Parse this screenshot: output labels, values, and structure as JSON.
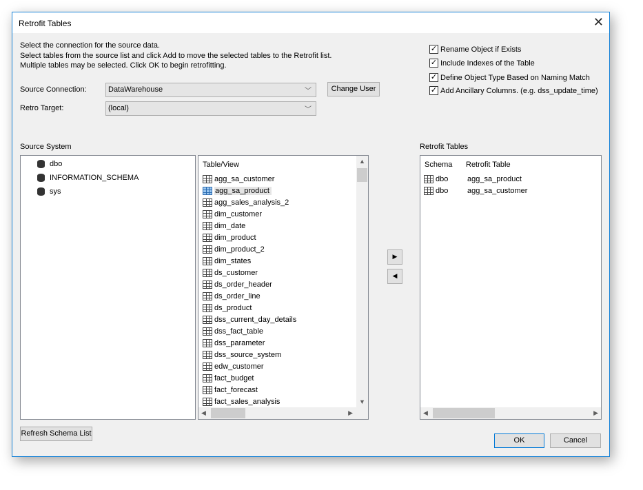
{
  "title": "Retrofit Tables",
  "instructions": [
    "Select the connection for the source data.",
    "Select tables from the source list and click Add to move the selected tables to the Retrofit list.",
    "Multiple tables may be selected. Click OK to begin retrofitting."
  ],
  "source_connection": {
    "label": "Source Connection:",
    "value": "DataWarehouse"
  },
  "retro_target": {
    "label": "Retro Target:",
    "value": "(local)"
  },
  "change_user": "Change User",
  "options": [
    {
      "label": "Rename Object if Exists",
      "checked": true
    },
    {
      "label": "Include Indexes of the Table",
      "checked": true
    },
    {
      "label": "Define Object Type Based on Naming Match",
      "checked": true
    },
    {
      "label": "Add Ancillary Columns. (e.g. dss_update_time)",
      "checked": true
    }
  ],
  "source_system": {
    "label": "Source System",
    "schemas": [
      "dbo",
      "INFORMATION_SCHEMA",
      "sys"
    ]
  },
  "table_list": {
    "header": "Table/View",
    "selected": "agg_sa_product",
    "items": [
      "agg_sa_customer",
      "agg_sa_product",
      "agg_sales_analysis_2",
      "dim_customer",
      "dim_date",
      "dim_product",
      "dim_product_2",
      "dim_states",
      "ds_customer",
      "ds_order_header",
      "ds_order_line",
      "ds_product",
      "dss_current_day_details",
      "dss_fact_table",
      "dss_parameter",
      "dss_source_system",
      "edw_customer",
      "fact_budget",
      "fact_forecast",
      "fact_sales_analysis"
    ]
  },
  "retrofit": {
    "label": "Retrofit Tables",
    "columns": [
      "Schema",
      "Retrofit Table"
    ],
    "rows": [
      [
        "dbo",
        "agg_sa_product"
      ],
      [
        "dbo",
        "agg_sa_customer"
      ]
    ]
  },
  "refresh": "Refresh Schema List",
  "ok": "OK",
  "cancel": "Cancel"
}
